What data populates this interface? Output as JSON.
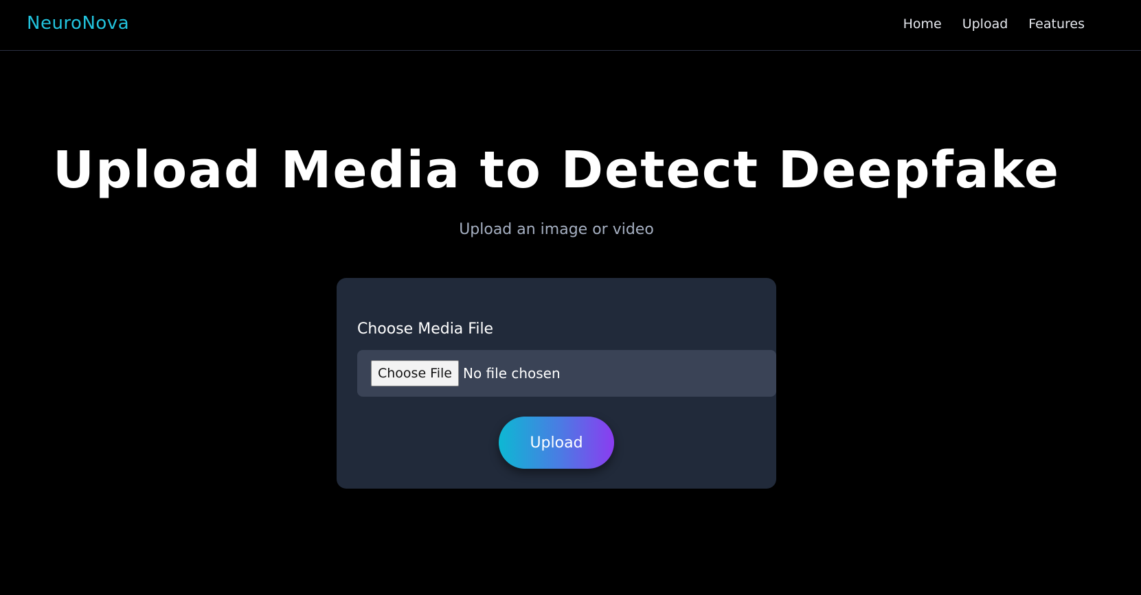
{
  "nav": {
    "brand": "NeuroNova",
    "links": [
      {
        "label": "Home"
      },
      {
        "label": "Upload"
      },
      {
        "label": "Features"
      }
    ]
  },
  "hero": {
    "title": "Upload Media to Detect Deepfake",
    "subtitle": "Upload an image or video"
  },
  "form": {
    "field_label": "Choose Media File",
    "choose_file_label": "Choose File",
    "file_status": "No file chosen",
    "submit_label": "Upload"
  },
  "colors": {
    "background": "#000000",
    "brand": "#22c3dd",
    "card": "#212a3a",
    "gradient_start": "#0db8d3",
    "gradient_end": "#8b3cf0"
  }
}
